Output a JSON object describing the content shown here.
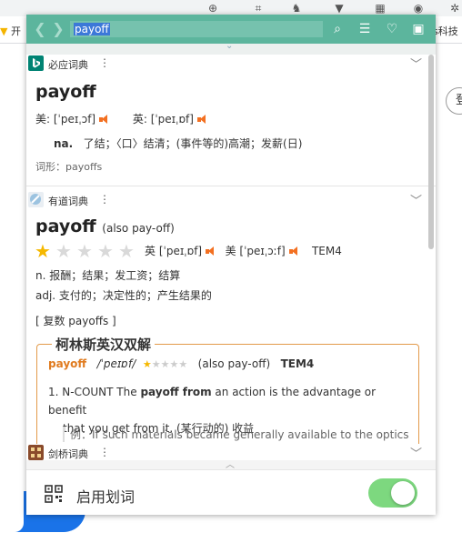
{
  "popup": {
    "search_value": "payoff",
    "colors": {
      "accent": "#5cb59d",
      "orange": "#f37021",
      "toggle_on": "#7dd87f",
      "collins_border": "#e39a4a"
    },
    "bing": {
      "name": "必应词典",
      "word": "payoff",
      "phon_us_label": "美:",
      "phon_us": "[ˈpeɪˌɔf]",
      "phon_uk_label": "英:",
      "phon_uk": "[ˈpeɪˌɒf]",
      "pos": "na.",
      "def": "了结；〈口〉结清；(事件等的)高潮；发薪(日)",
      "forms": "词形：payoffs"
    },
    "youdao": {
      "name": "有道词典",
      "word": "payoff",
      "also": "(also pay-off)",
      "rating": 1,
      "rating_max": 5,
      "phon_uk_label": "英",
      "phon_uk": "[ˈpeɪˌɒf]",
      "phon_us_label": "美",
      "phon_us": "[ˈpeɪˌɔːf]",
      "exam": "TEM4",
      "def_n": "n. 报酬；结果；发工资；结算",
      "def_adj": "adj. 支付的；决定性的；产生结果的",
      "plural": "[ 复数 payoffs ]"
    },
    "collins": {
      "title": "柯林斯英汉双解",
      "word": "payoff",
      "phon": "/ˈpeɪɒf/",
      "also": "(also pay-off)",
      "exam": "TEM4",
      "rating": 1,
      "rating_max": 5,
      "sense_prefix": "1. N-COUNT The ",
      "sense_bold1": "payoff from",
      "sense_mid": " an action is the advantage or benefit",
      "sense_line2": "that you get from it. (某行动的) 收益",
      "example": "例：If such materials became generally available to the optics"
    },
    "cambridge": {
      "name": "剑桥词典"
    },
    "footer": {
      "label": "启用划词"
    }
  },
  "browser": {
    "bookmark_left": "开",
    "bookmark_right": "s科技",
    "side_button_label": "登"
  }
}
